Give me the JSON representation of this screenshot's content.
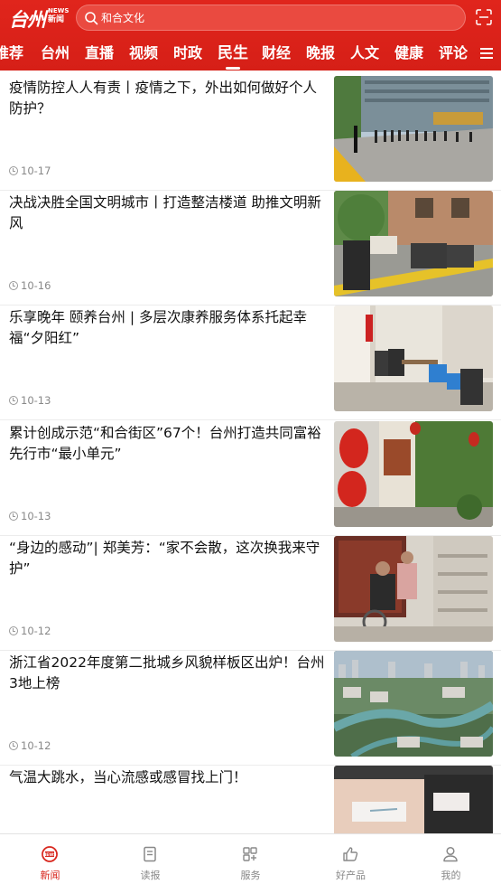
{
  "header": {
    "logo": {
      "text": "台州",
      "news_en": "NEWS",
      "news_cn": "新闻"
    },
    "search": {
      "text": "和合文化"
    },
    "scan_icon": "scan-icon"
  },
  "tabs": [
    {
      "label": "推荐"
    },
    {
      "label": "台州"
    },
    {
      "label": "直播"
    },
    {
      "label": "视频"
    },
    {
      "label": "时政"
    },
    {
      "label": "民生",
      "active": true
    },
    {
      "label": "财经"
    },
    {
      "label": "晚报"
    },
    {
      "label": "人文"
    },
    {
      "label": "健康"
    },
    {
      "label": "评论"
    }
  ],
  "articles": [
    {
      "title": "疫情防控人人有责丨疫情之下，外出如何做好个人防护？",
      "date": "10-17"
    },
    {
      "title": "决战决胜全国文明城市丨打造整洁楼道 助推文明新风",
      "date": "10-16"
    },
    {
      "title": "乐享晚年 颐养台州 | 多层次康养服务体系托起幸福“夕阳红”",
      "date": "10-13"
    },
    {
      "title": "累计创成示范“和合街区”67个！台州打造共同富裕先行市“最小单元”",
      "date": "10-13"
    },
    {
      "title": "“身边的感动”| 郑美芳：“家不会散，这次换我来守护”",
      "date": "10-12"
    },
    {
      "title": "浙江省2022年度第二批城乡风貌样板区出炉！台州3地上榜",
      "date": "10-12"
    },
    {
      "title": "气温大跳水，当心流感或感冒找上门！",
      "date": ""
    }
  ],
  "bottom_nav": [
    {
      "label": "新闻",
      "icon": "news-icon",
      "active": true
    },
    {
      "label": "读报",
      "icon": "newspaper-icon"
    },
    {
      "label": "服务",
      "icon": "grid-icon"
    },
    {
      "label": "好产品",
      "icon": "thumbs-up-icon"
    },
    {
      "label": "我的",
      "icon": "user-icon"
    }
  ],
  "colors": {
    "brand_red": "#d8261d",
    "date_gray": "#888888"
  }
}
